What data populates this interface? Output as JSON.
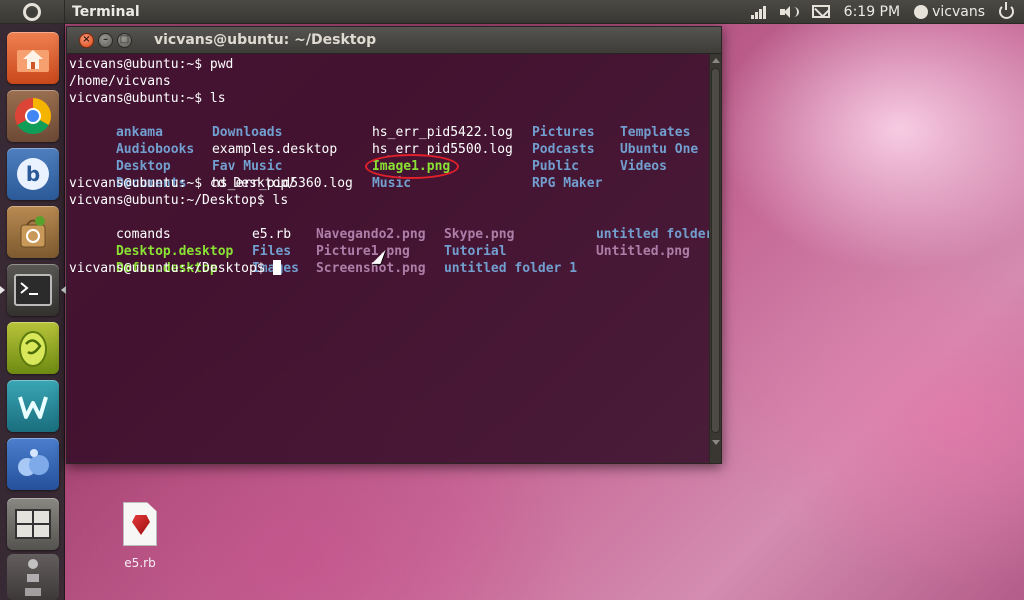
{
  "top_panel": {
    "app_title": "Terminal",
    "time": "6:19 PM",
    "user": "vicvans"
  },
  "launcher": {
    "items": [
      {
        "name": "home-folder",
        "icon": "home-folder-icon"
      },
      {
        "name": "chromium",
        "icon": "chrome-icon"
      },
      {
        "name": "app-b",
        "icon": "b-app-icon"
      },
      {
        "name": "software-center",
        "icon": "software-center-icon"
      },
      {
        "name": "terminal",
        "icon": "terminal-icon"
      },
      {
        "name": "app-egg",
        "icon": "egg-app-icon"
      },
      {
        "name": "app-w",
        "icon": "w-app-icon"
      },
      {
        "name": "app-blue",
        "icon": "blue-app-icon"
      },
      {
        "name": "workspace-switcher",
        "icon": "workspace-switcher-icon"
      }
    ]
  },
  "window": {
    "title": "vicvans@ubuntu: ~/Desktop"
  },
  "terminal": {
    "lines": [
      "vicvans@ubuntu:~$ pwd",
      "/home/vicvans",
      "vicvans@ubuntu:~$ ls",
      "vicvans@ubuntu:~$ cd Desktop/",
      "vicvans@ubuntu:~/Desktop$ ls",
      "vicvans@ubuntu:~/Desktop$ "
    ],
    "ls_home": [
      [
        "ankama",
        "Downloads",
        "hs_err_pid5422.log",
        "Pictures",
        "Templates"
      ],
      [
        "Audiobooks",
        "examples.desktop",
        "hs_err_pid5500.log",
        "Podcasts",
        "Ubuntu One"
      ],
      [
        "Desktop",
        "Fav Music",
        "Image1.png",
        "Public",
        "Videos"
      ],
      [
        "Documents",
        "hs_err_pid5360.log",
        "Music",
        "RPG Maker",
        ""
      ]
    ],
    "ls_desktop": [
      [
        "comands",
        "e5.rb",
        "Navegando2.png",
        "Skype.png",
        "",
        "untitled folder2"
      ],
      [
        "Desktop.desktop",
        "Files",
        "Picture1.png",
        "Tutorial",
        "",
        "Untitled.png"
      ],
      [
        "Dofus.desktop",
        "Images",
        "Screenshot.png",
        "untitled folder 1",
        "",
        ""
      ]
    ]
  },
  "desktop": {
    "icons": [
      "e5.rb"
    ]
  }
}
